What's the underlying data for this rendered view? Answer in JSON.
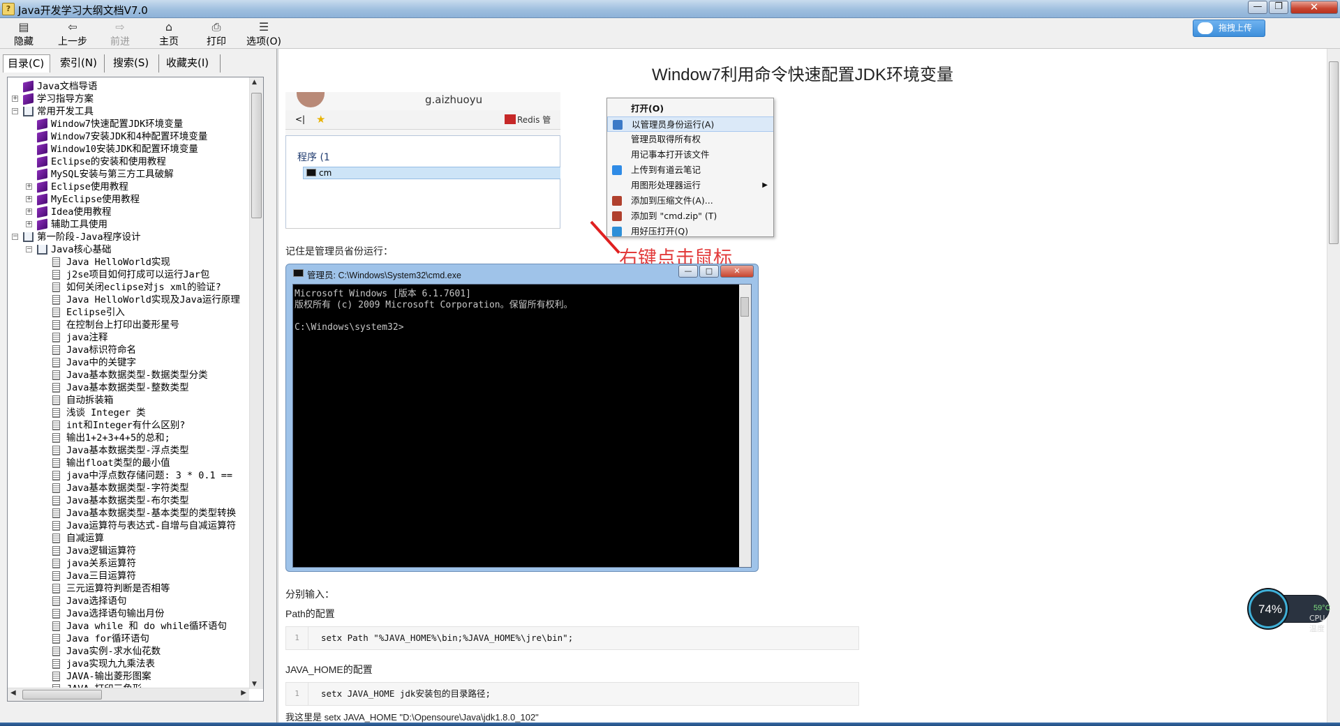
{
  "window": {
    "title": "Java开发学习大纲文档V7.0",
    "icon": "help-file-icon",
    "min": "—",
    "max": "❐",
    "close": "✕"
  },
  "toolbar": {
    "buttons": [
      {
        "label": "隐藏",
        "icon": "hide-icon"
      },
      {
        "label": "上一步",
        "icon": "back-arrow-icon"
      },
      {
        "label": "前进",
        "icon": "forward-arrow-icon"
      },
      {
        "label": "主页",
        "icon": "home-icon"
      },
      {
        "label": "打印",
        "icon": "print-icon"
      },
      {
        "label": "选项(O)",
        "icon": "options-icon"
      }
    ],
    "upload_label": "拖拽上传"
  },
  "left_tabs": [
    "目录(C)",
    "索引(N)",
    "搜索(S)",
    "收藏夹(I)"
  ],
  "tree": [
    {
      "label": "Java文档导语",
      "level": 0,
      "type": "book",
      "exp": ""
    },
    {
      "label": "学习指导方案",
      "level": 0,
      "type": "book",
      "exp": "+"
    },
    {
      "label": "常用开发工具",
      "level": 0,
      "type": "open",
      "exp": "−"
    },
    {
      "label": "Window7快速配置JDK环境变量",
      "level": 1,
      "type": "book",
      "exp": ""
    },
    {
      "label": "Window7安装JDK和4种配置环境变量",
      "level": 1,
      "type": "book",
      "exp": ""
    },
    {
      "label": "Window10安装JDK和配置环境变量",
      "level": 1,
      "type": "book",
      "exp": ""
    },
    {
      "label": "Eclipse的安装和使用教程",
      "level": 1,
      "type": "book",
      "exp": ""
    },
    {
      "label": "MySQL安装与第三方工具破解",
      "level": 1,
      "type": "book",
      "exp": ""
    },
    {
      "label": "Eclipse使用教程",
      "level": 1,
      "type": "book",
      "exp": "+"
    },
    {
      "label": "MyEclipse使用教程",
      "level": 1,
      "type": "book",
      "exp": "+"
    },
    {
      "label": "Idea使用教程",
      "level": 1,
      "type": "book",
      "exp": "+"
    },
    {
      "label": "辅助工具使用",
      "level": 1,
      "type": "book",
      "exp": "+"
    },
    {
      "label": "第一阶段-Java程序设计",
      "level": 0,
      "type": "open",
      "exp": "−"
    },
    {
      "label": "Java核心基础",
      "level": 1,
      "type": "open",
      "exp": "−"
    },
    {
      "label": "Java HelloWorld实现",
      "level": 2,
      "type": "page",
      "exp": ""
    },
    {
      "label": "j2se项目如何打成可以运行Jar包",
      "level": 2,
      "type": "page",
      "exp": ""
    },
    {
      "label": "如何关闭eclipse对js xml的验证?",
      "level": 2,
      "type": "page",
      "exp": ""
    },
    {
      "label": "Java HelloWorld实现及Java运行原理",
      "level": 2,
      "type": "page",
      "exp": ""
    },
    {
      "label": "Eclipse引入",
      "level": 2,
      "type": "page",
      "exp": ""
    },
    {
      "label": "在控制台上打印出菱形星号",
      "level": 2,
      "type": "page",
      "exp": ""
    },
    {
      "label": "java注释",
      "level": 2,
      "type": "page",
      "exp": ""
    },
    {
      "label": "Java标识符命名",
      "level": 2,
      "type": "page",
      "exp": ""
    },
    {
      "label": "Java中的关键字",
      "level": 2,
      "type": "page",
      "exp": ""
    },
    {
      "label": "Java基本数据类型-数据类型分类",
      "level": 2,
      "type": "page",
      "exp": ""
    },
    {
      "label": "Java基本数据类型-整数类型",
      "level": 2,
      "type": "page",
      "exp": ""
    },
    {
      "label": "自动拆装箱",
      "level": 2,
      "type": "page",
      "exp": ""
    },
    {
      "label": "浅谈 Integer 类",
      "level": 2,
      "type": "page",
      "exp": ""
    },
    {
      "label": "int和Integer有什么区别?",
      "level": 2,
      "type": "page",
      "exp": ""
    },
    {
      "label": "输出1+2+3+4+5的总和;",
      "level": 2,
      "type": "page",
      "exp": ""
    },
    {
      "label": "Java基本数据类型-浮点类型",
      "level": 2,
      "type": "page",
      "exp": ""
    },
    {
      "label": "输出float类型的最小值",
      "level": 2,
      "type": "page",
      "exp": ""
    },
    {
      "label": "java中浮点数存储问题: 3 * 0.1 ==",
      "level": 2,
      "type": "page",
      "exp": ""
    },
    {
      "label": "Java基本数据类型-字符类型",
      "level": 2,
      "type": "page",
      "exp": ""
    },
    {
      "label": "Java基本数据类型-布尔类型",
      "level": 2,
      "type": "page",
      "exp": ""
    },
    {
      "label": "Java基本数据类型-基本类型的类型转换",
      "level": 2,
      "type": "page",
      "exp": ""
    },
    {
      "label": "Java运算符与表达式-自增与自减运算符",
      "level": 2,
      "type": "page",
      "exp": ""
    },
    {
      "label": "自减运算",
      "level": 2,
      "type": "page",
      "exp": ""
    },
    {
      "label": "Java逻辑运算符",
      "level": 2,
      "type": "page",
      "exp": ""
    },
    {
      "label": "java关系运算符",
      "level": 2,
      "type": "page",
      "exp": ""
    },
    {
      "label": "Java三目运算符",
      "level": 2,
      "type": "page",
      "exp": ""
    },
    {
      "label": "三元运算符判断是否相等",
      "level": 2,
      "type": "page",
      "exp": ""
    },
    {
      "label": "Java选择语句",
      "level": 2,
      "type": "page",
      "exp": ""
    },
    {
      "label": "Java选择语句输出月份",
      "level": 2,
      "type": "page",
      "exp": ""
    },
    {
      "label": "Java while 和 do while循环语句",
      "level": 2,
      "type": "page",
      "exp": ""
    },
    {
      "label": "Java for循环语句",
      "level": 2,
      "type": "page",
      "exp": ""
    },
    {
      "label": "Java实例-求水仙花数",
      "level": 2,
      "type": "page",
      "exp": ""
    },
    {
      "label": "java实现九九乘法表",
      "level": 2,
      "type": "page",
      "exp": ""
    },
    {
      "label": "JAVA-输出菱形图案",
      "level": 2,
      "type": "page",
      "exp": ""
    },
    {
      "label": "JAVA 打印三角形",
      "level": 2,
      "type": "page",
      "exp": ""
    }
  ],
  "article": {
    "title": "Window7利用命令快速配置JDK环境变量",
    "screenshot1": {
      "url_fragment": "g.aizhuoyu",
      "bookmark": "Redis 管",
      "program_label": "程序 (1",
      "program_item": "cm",
      "context_menu": [
        {
          "label": "打开(O)",
          "bold": true,
          "hl": false,
          "icon": "",
          "sub": false
        },
        {
          "label": "以管理员身份运行(A)",
          "bold": false,
          "hl": true,
          "icon": "shield-icon",
          "sub": false
        },
        {
          "label": "管理员取得所有权",
          "bold": false,
          "hl": false,
          "icon": "",
          "sub": false
        },
        {
          "label": "用记事本打开该文件",
          "bold": false,
          "hl": false,
          "icon": "",
          "sub": false
        },
        {
          "label": "上传到有道云笔记",
          "bold": false,
          "hl": false,
          "icon": "youdao-icon",
          "sub": false
        },
        {
          "label": "用图形处理器运行",
          "bold": false,
          "hl": false,
          "icon": "",
          "sub": true
        },
        {
          "label": "添加到压缩文件(A)...",
          "bold": false,
          "hl": false,
          "icon": "winrar-icon",
          "sub": false
        },
        {
          "label": "添加到 \"cmd.zip\" (T)",
          "bold": false,
          "hl": false,
          "icon": "winrar-icon",
          "sub": false
        },
        {
          "label": "用好压打开(Q)",
          "bold": false,
          "hl": false,
          "icon": "haozip-icon",
          "sub": false
        }
      ],
      "annotation": "右键点击鼠标"
    },
    "note_admin": "记住是管理员省份运行：",
    "cmd": {
      "title": "管理员: C:\\Windows\\System32\\cmd.exe",
      "lines": "Microsoft Windows [版本 6.1.7601]\n版权所有 (c) 2009 Microsoft Corporation。保留所有权利。\n\nC:\\Windows\\system32>"
    },
    "note_input": "分别输入：",
    "path_heading": "Path的配置",
    "code1": {
      "line": "1",
      "text": "setx Path \"%JAVA_HOME%\\bin;%JAVA_HOME%\\jre\\bin\";"
    },
    "java_home_heading": "JAVA_HOME的配置",
    "code2": {
      "line": "1",
      "text": "setx JAVA_HOME jdk安装包的目录路径;"
    },
    "mine": "我这里是  setx JAVA_HOME \"D:\\Opensoure\\Java\\jdk1.8.0_102\""
  },
  "cpu_widget": {
    "percent": "74%",
    "temp": "59°C",
    "label": "CPU温度"
  },
  "colors": {
    "accent": "#3e8fdb",
    "annotation": "#e23a3a",
    "cpu_ring": "#3fb0d8"
  }
}
